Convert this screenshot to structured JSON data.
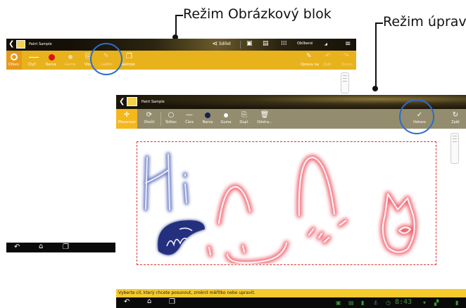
{
  "callouts": {
    "left": "Režim Obrázkový blok",
    "right": "Režim úprav"
  },
  "back_screen": {
    "app_title": "Paint Sample",
    "share_label": "Sdílet",
    "favorites_label": "Oblíbené",
    "tools": [
      {
        "label": "Dřevo",
        "icon": "circle-icon"
      },
      {
        "label": "Čtyř.",
        "icon": "line-icon"
      },
      {
        "label": "Barva",
        "icon": "color-dot-icon"
      },
      {
        "label": "Guma",
        "icon": "eraser-icon"
      },
      {
        "label": "Vlož",
        "icon": "insert-icon"
      },
      {
        "label": "Ladění",
        "icon": "edit-icon"
      },
      {
        "label": "Nástroje",
        "icon": "tools-icon"
      }
    ],
    "right_tools": [
      {
        "label": "Úpravy na",
        "icon": "pencil-icon"
      },
      {
        "label": "Zpět",
        "icon": "undo-icon"
      },
      {
        "label": "Znovu",
        "icon": "redo-icon"
      }
    ]
  },
  "front_screen": {
    "app_title": "Paint Sample",
    "tools": [
      {
        "label": "Přesunout",
        "icon": "move-icon",
        "active": true
      },
      {
        "label": "Otočit",
        "icon": "rotate-icon"
      },
      {
        "label": "Štětec",
        "icon": "brush-icon"
      },
      {
        "label": "Čára",
        "icon": "line-icon"
      },
      {
        "label": "Barva",
        "icon": "color-dot-icon"
      },
      {
        "label": "Guma",
        "icon": "eraser-icon"
      },
      {
        "label": "Dupl.",
        "icon": "duplicate-icon"
      },
      {
        "label": "Odstra...",
        "icon": "trash-icon"
      }
    ],
    "done_label": "Hotovo",
    "undo_label": "Zpět",
    "status_text": "Vyberte cíl, který chcete posunout, změnit měřítko nebo upravit.",
    "clock": "8:43",
    "colors": {
      "accent": "#f5b81c",
      "toolbar": "#938c6e",
      "selection": "#e0302a",
      "highlight": "#2a6dcc"
    }
  }
}
